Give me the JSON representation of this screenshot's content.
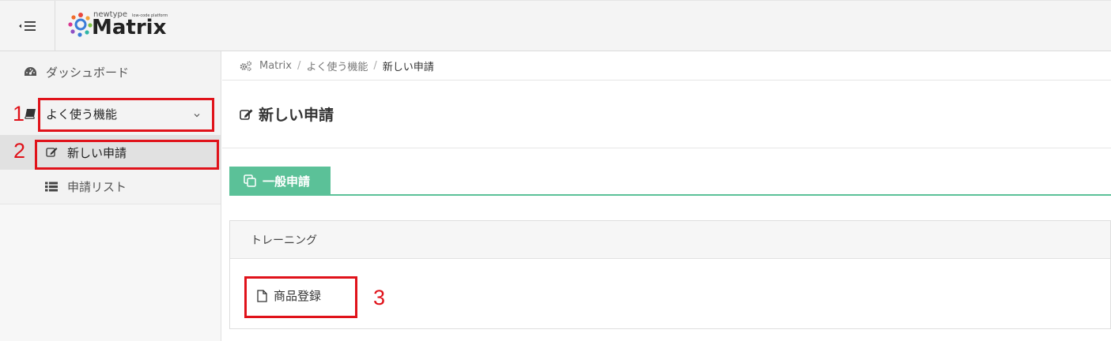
{
  "app": {
    "brand": "Matrix",
    "tagline": "newtype",
    "tagline_small": "low-code platform"
  },
  "sidebar": {
    "dashboard_label": "ダッシュボード",
    "group_label": "よく使う機能",
    "items": [
      {
        "label": "新しい申請",
        "icon": "edit-icon",
        "active": true
      },
      {
        "label": "申請リスト",
        "icon": "list-icon",
        "active": false
      }
    ]
  },
  "breadcrumb": {
    "items": [
      "Matrix",
      "よく使う機能",
      "新しい申請"
    ]
  },
  "page": {
    "title": "新しい申請"
  },
  "tabs": [
    {
      "label": "一般申請",
      "icon": "copy-icon",
      "active": true
    }
  ],
  "panel": {
    "header": "トレーニング",
    "links": [
      {
        "label": "商品登録",
        "icon": "file-icon"
      }
    ]
  },
  "annotations": [
    "1",
    "2",
    "3"
  ],
  "colors": {
    "accent": "#5bc198",
    "annotation_red": "#e0121a",
    "sidebar_bg": "#f3f3f3",
    "active_bg": "#e1e1e1"
  }
}
